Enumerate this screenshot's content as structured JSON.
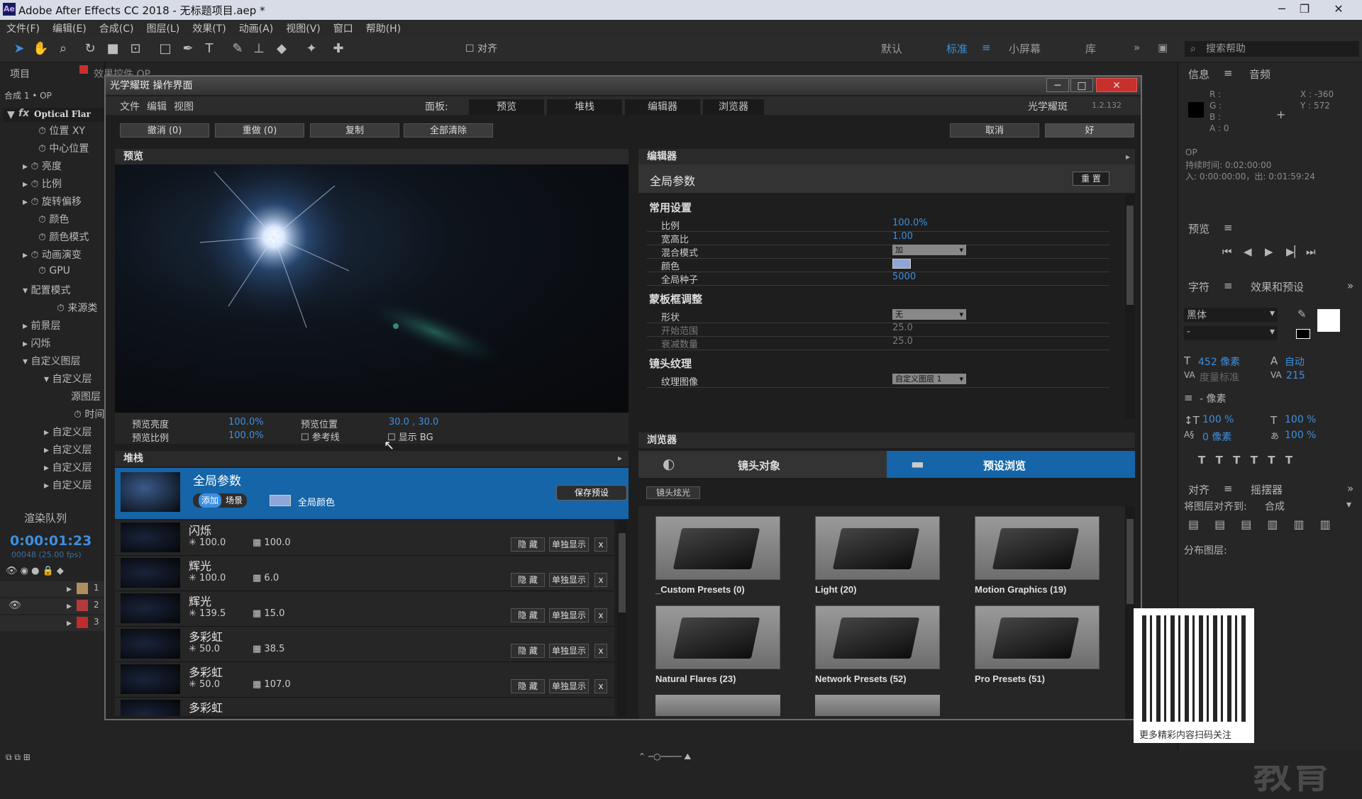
{
  "window": {
    "title": "Adobe After Effects CC 2018 - 无标题项目.aep *"
  },
  "menu": [
    "文件(F)",
    "编辑(E)",
    "合成(C)",
    "图层(L)",
    "效果(T)",
    "动画(A)",
    "视图(V)",
    "窗口",
    "帮助(H)"
  ],
  "toolbar": {
    "align_label": "对齐",
    "workspaces": [
      "默认",
      "标准",
      "小屏幕",
      "库"
    ],
    "search_help": "搜索帮助"
  },
  "left_panel": {
    "tab": "项目",
    "tab2": "效果控件 OP",
    "comp_label": "合成 1 • OP",
    "effect_name": "Optical Flar",
    "tree": [
      "位置 XY",
      "中心位置",
      "亮度",
      "比例",
      "旋转偏移",
      "颜色",
      "颜色模式",
      "动画演变",
      "GPU",
      "配置模式",
      "来源类",
      "前景层",
      "闪烁",
      "自定义图层",
      "自定义层",
      "源图层",
      "时间",
      "自定义层",
      "自定义层",
      "自定义层",
      "自定义层"
    ],
    "render_queue": "渲染队列",
    "timecode": "0:00:01:23",
    "frames": "00048 (25.00 fps)",
    "track_nums": [
      "1",
      "2",
      "3"
    ]
  },
  "right_panel": {
    "info_tab": "信息",
    "audio_tab": "音频",
    "rgb": [
      "R :",
      "G :",
      "B :",
      "A : 0"
    ],
    "xy": [
      "X : -360",
      "Y : 572"
    ],
    "layer": "OP",
    "duration": "持续时间: 0:02:00:00",
    "in_out": "入: 0:00:00:00，出: 0:01:59:24",
    "preview_tab": "预览",
    "char_tab": "字符",
    "effects_tab": "效果和预设",
    "font": "黑体",
    "font_style": "-",
    "size": "452 像素",
    "leading": "自动",
    "tracking_label": "度量标准",
    "tracking_val": "215",
    "stroke_px": "- 像素",
    "vscale": "100 %",
    "hscale": "100 %",
    "baseline": "0 像素",
    "tsume": "100 %",
    "align_tab": "对齐",
    "wiggler_tab": "摇摆器",
    "align_to_label": "将图层对齐到:",
    "align_to_val": "合成",
    "distribute": "分布图层:",
    "watermark": "教育"
  },
  "dialog": {
    "title": "光学耀斑 操作界面",
    "menu": [
      "文件",
      "编辑",
      "视图"
    ],
    "panel_label": "面板:",
    "tabs": [
      "预览",
      "堆栈",
      "编辑器",
      "浏览器"
    ],
    "brand": "光学耀斑",
    "version": "1.2.132",
    "actions": [
      "撤消 (0)",
      "重做 (0)",
      "复制",
      "全部清除"
    ],
    "cancel": "取消",
    "ok": "好",
    "preview": {
      "header": "预览",
      "brightness_label": "预览亮度",
      "brightness_val": "100.0%",
      "scale_label": "预览比例",
      "scale_val": "100.0%",
      "pos_label": "预览位置",
      "pos_val": "30.0 , 30.0",
      "guides": "参考线",
      "show_bg": "显示 BG"
    },
    "editor": {
      "header": "编辑器",
      "section": "全局参数",
      "reset": "重 置",
      "groups": [
        {
          "title": "常用设置",
          "rows": [
            {
              "k": "比例",
              "v": "100.0%"
            },
            {
              "k": "宽高比",
              "v": "1.00"
            },
            {
              "k": "混合模式",
              "v": "加"
            },
            {
              "k": "颜色",
              "v": ""
            },
            {
              "k": "全局种子",
              "v": "5000"
            }
          ]
        },
        {
          "title": "蒙板框调整",
          "rows": [
            {
              "k": "形状",
              "v": "无"
            },
            {
              "k": "开始范围",
              "v": "25.0"
            },
            {
              "k": "衰减数量",
              "v": "25.0"
            }
          ]
        },
        {
          "title": "镜头纹理",
          "rows": [
            {
              "k": "纹理图像",
              "v": "自定义图层 1"
            }
          ]
        }
      ]
    },
    "stack": {
      "header": "堆栈",
      "global": {
        "title": "全局参数",
        "add": "添加",
        "scene": "场景",
        "global_color": "全局颜色",
        "save": "保存预设"
      },
      "layers": [
        {
          "name": "闪烁",
          "v1": "100.0",
          "v2": "100.0"
        },
        {
          "name": "辉光",
          "v1": "100.0",
          "v2": "6.0"
        },
        {
          "name": "辉光",
          "v1": "139.5",
          "v2": "15.0"
        },
        {
          "name": "多彩虹",
          "v1": "50.0",
          "v2": "38.5"
        },
        {
          "name": "多彩虹",
          "v1": "50.0",
          "v2": "107.0"
        },
        {
          "name": "多彩虹",
          "v1": "",
          "v2": ""
        }
      ],
      "hide": "隐 藏",
      "solo": "单独显示",
      "x": "x"
    },
    "browser": {
      "header": "浏览器",
      "tab_objects": "镜头对象",
      "tab_presets": "预设浏览",
      "filter": "镜头炫光",
      "folders": [
        "_Custom Presets (0)",
        "Light (20)",
        "Motion Graphics (19)",
        "Natural Flares (23)",
        "Network Presets (52)",
        "Pro Presets (51)"
      ]
    }
  },
  "qr": {
    "caption": "更多精彩内容扫码关注"
  },
  "colors": {
    "accent": "#3d8fe0",
    "selected": "#1565a8",
    "titlebar_close": "#c7302c"
  }
}
